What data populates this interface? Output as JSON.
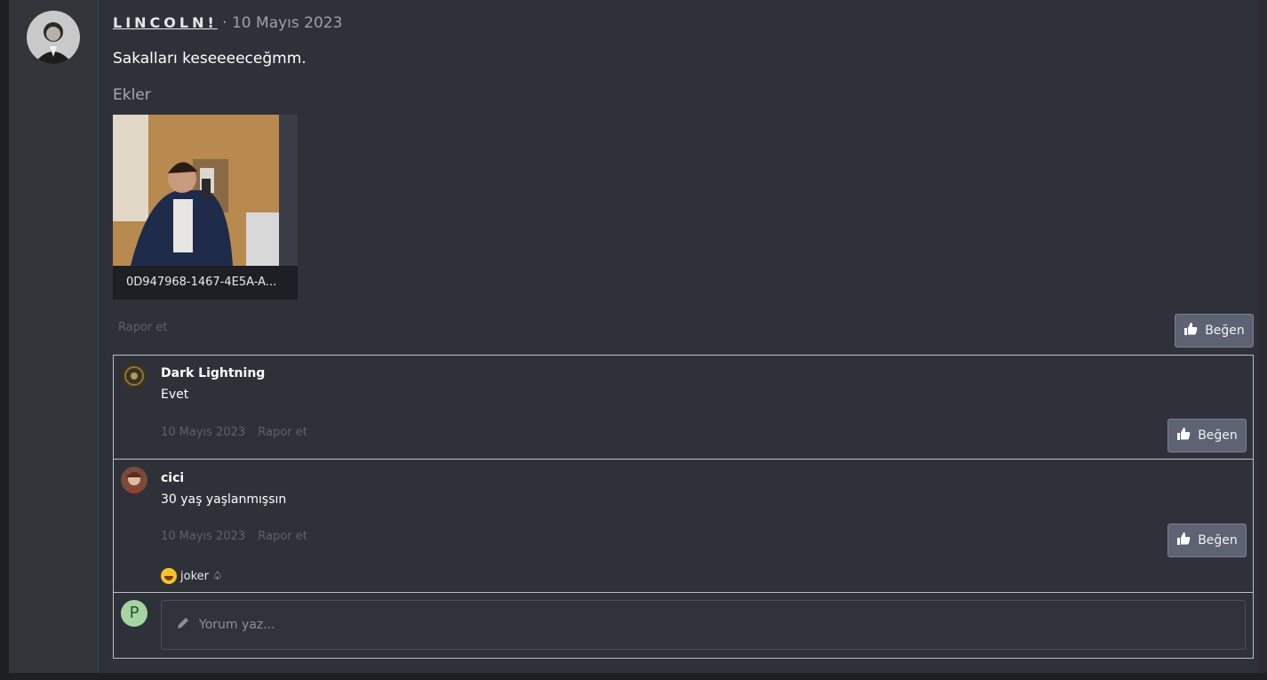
{
  "post": {
    "username": "LINCOLN!",
    "date_sep": "·",
    "date": "10 Mayıs 2023",
    "text": "Sakalları keseeeeceğmm.",
    "attachments_title": "Ekler",
    "attachment_name": "0D947968-1467-4E5A-A...",
    "report_label": "Rapor et",
    "like_label": "Beğen"
  },
  "comments": [
    {
      "author": "Dark Lightning",
      "text": "Evet",
      "date": "10 Mayıs 2023",
      "report_label": "Rapor et",
      "like_label": "Beğen"
    },
    {
      "author": "cici",
      "text": "30 yaş yaşlanmışsın",
      "date": "10 Mayıs 2023",
      "report_label": "Rapor et",
      "like_label": "Beğen",
      "signature": "joker"
    }
  ],
  "composer": {
    "avatar_letter": "P",
    "placeholder": "Yorum yaz..."
  },
  "icons": {
    "like": "thumbs-up-icon",
    "compose": "pencil-icon",
    "signature": "rofl-emoji-icon"
  },
  "colors": {
    "background": "#2f3139",
    "button": "#5d6373",
    "avatar_p": "#a6d5a1"
  }
}
